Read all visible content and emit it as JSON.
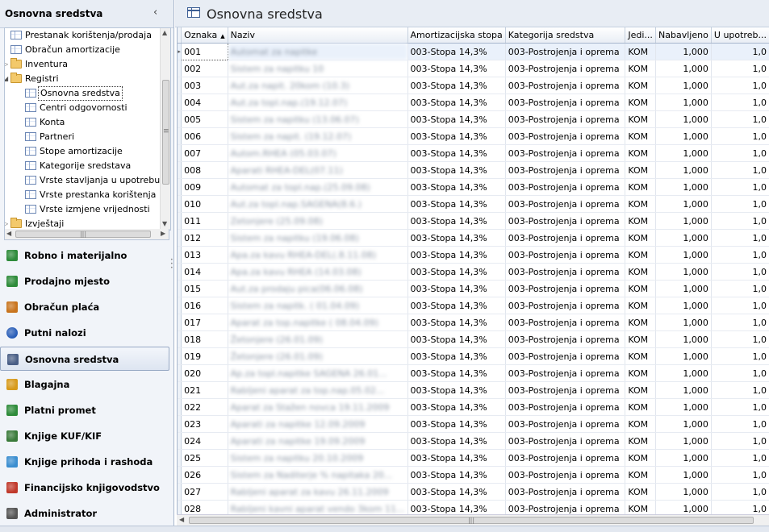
{
  "sidebar": {
    "title": "Osnovna sredstva",
    "collapse_icon": "‹",
    "tree": [
      {
        "label": "Prestanak korištenja/prodaja",
        "icon": "grid",
        "level": 0
      },
      {
        "label": "Obračun amortizacije",
        "icon": "grid",
        "level": 0
      },
      {
        "label": "Inventura",
        "icon": "folder",
        "level": 0,
        "expander": "▷"
      },
      {
        "label": "Registri",
        "icon": "folder",
        "level": 0,
        "expander": "◢"
      },
      {
        "label": "Osnovna sredstva",
        "icon": "grid",
        "level": 1,
        "selected": true
      },
      {
        "label": "Centri odgovornosti",
        "icon": "grid",
        "level": 1
      },
      {
        "label": "Konta",
        "icon": "grid",
        "level": 1
      },
      {
        "label": "Partneri",
        "icon": "grid",
        "level": 1
      },
      {
        "label": "Stope amortizacije",
        "icon": "grid",
        "level": 1
      },
      {
        "label": "Kategorije sredstava",
        "icon": "grid",
        "level": 1
      },
      {
        "label": "Vrste stavljanja u upotrebu",
        "icon": "grid",
        "level": 1
      },
      {
        "label": "Vrste prestanka korištenja",
        "icon": "grid",
        "level": 1
      },
      {
        "label": "Vrste izmjene vrijednosti",
        "icon": "grid",
        "level": 1
      },
      {
        "label": "Izvještaji",
        "icon": "folder",
        "level": 0,
        "expander": "▷"
      }
    ],
    "modules": [
      {
        "label": "Robno i materijalno",
        "icon": "robno-icon",
        "color": "#2e8b3a"
      },
      {
        "label": "Prodajno mjesto",
        "icon": "pos-icon",
        "color": "#2e8b3a"
      },
      {
        "label": "Obračun plaća",
        "icon": "payroll-icon",
        "color": "#c8741e"
      },
      {
        "label": "Putni nalozi",
        "icon": "globe-icon",
        "color": "#2b5fb8"
      },
      {
        "label": "Osnovna sredstva",
        "icon": "assets-icon",
        "color": "#4a5f86",
        "active": true
      },
      {
        "label": "Blagajna",
        "icon": "cash-icon",
        "color": "#d79a1c"
      },
      {
        "label": "Platni promet",
        "icon": "payment-icon",
        "color": "#2e8b3a"
      },
      {
        "label": "Knjige KUF/KIF",
        "icon": "books-icon",
        "color": "#3a7a3a"
      },
      {
        "label": "Knjige prihoda i rashoda",
        "icon": "shield-icon",
        "color": "#3b8ed0"
      },
      {
        "label": "Financijsko knjigovodstvo",
        "icon": "bar-chart-icon",
        "color": "#c0392b"
      },
      {
        "label": "Administrator",
        "icon": "admin-icon",
        "color": "#555555"
      }
    ]
  },
  "content": {
    "title": "Osnovna sredstva",
    "columns": [
      "Oznaka",
      "Naziv",
      "Amortizacijska stopa",
      "Kategorija sredstva",
      "Jedi...",
      "Nabavljeno",
      "U upotreb..."
    ],
    "sort_indicator": "▲",
    "rows": [
      {
        "oznaka": "001",
        "naziv": "Automat za napitke",
        "stopa": "003-Stopa 14,3%",
        "kategorija": "003-Postrojenja i oprema",
        "jed": "KOM",
        "nab": "1,000",
        "upo": "1,0"
      },
      {
        "oznaka": "002",
        "naziv": "Sistem za napitku 10",
        "stopa": "003-Stopa 14,3%",
        "kategorija": "003-Postrojenja i oprema",
        "jed": "KOM",
        "nab": "1,000",
        "upo": "1,0"
      },
      {
        "oznaka": "003",
        "naziv": "Aut.za napit. 20kom (10.3)",
        "stopa": "003-Stopa 14,3%",
        "kategorija": "003-Postrojenja i oprema",
        "jed": "KOM",
        "nab": "1,000",
        "upo": "1,0"
      },
      {
        "oznaka": "004",
        "naziv": "Aut.za topl.nap.(19.12.07)",
        "stopa": "003-Stopa 14,3%",
        "kategorija": "003-Postrojenja i oprema",
        "jed": "KOM",
        "nab": "1,000",
        "upo": "1,0"
      },
      {
        "oznaka": "005",
        "naziv": "Sistem za napitku (13.06.07)",
        "stopa": "003-Stopa 14,3%",
        "kategorija": "003-Postrojenja i oprema",
        "jed": "KOM",
        "nab": "1,000",
        "upo": "1,0"
      },
      {
        "oznaka": "006",
        "naziv": "Sistem za napit. (19.12.07)",
        "stopa": "003-Stopa 14,3%",
        "kategorija": "003-Postrojenja i oprema",
        "jed": "KOM",
        "nab": "1,000",
        "upo": "1,0"
      },
      {
        "oznaka": "007",
        "naziv": "Autom.RHEA (05.03.07)",
        "stopa": "003-Stopa 14,3%",
        "kategorija": "003-Postrojenja i oprema",
        "jed": "KOM",
        "nab": "1,000",
        "upo": "1,0"
      },
      {
        "oznaka": "008",
        "naziv": "Aparati RHEA-DEL(07.11)",
        "stopa": "003-Stopa 14,3%",
        "kategorija": "003-Postrojenja i oprema",
        "jed": "KOM",
        "nab": "1,000",
        "upo": "1,0"
      },
      {
        "oznaka": "009",
        "naziv": "Automat za topl.nap.(25.09.08)",
        "stopa": "003-Stopa 14,3%",
        "kategorija": "003-Postrojenja i oprema",
        "jed": "KOM",
        "nab": "1,000",
        "upo": "1,0"
      },
      {
        "oznaka": "010",
        "naziv": "Aut.za topl.nap.SAGENA(8.6.)",
        "stopa": "003-Stopa 14,3%",
        "kategorija": "003-Postrojenja i oprema",
        "jed": "KOM",
        "nab": "1,000",
        "upo": "1,0"
      },
      {
        "oznaka": "011",
        "naziv": "Zetonjere (25.09.08)",
        "stopa": "003-Stopa 14,3%",
        "kategorija": "003-Postrojenja i oprema",
        "jed": "KOM",
        "nab": "1,000",
        "upo": "1,0"
      },
      {
        "oznaka": "012",
        "naziv": "Sistem za napitku (19.06.08)",
        "stopa": "003-Stopa 14,3%",
        "kategorija": "003-Postrojenja i oprema",
        "jed": "KOM",
        "nab": "1,000",
        "upo": "1,0"
      },
      {
        "oznaka": "013",
        "naziv": "Apa.za kavu RHEA-DEL(.8.11.08)",
        "stopa": "003-Stopa 14,3%",
        "kategorija": "003-Postrojenja i oprema",
        "jed": "KOM",
        "nab": "1,000",
        "upo": "1,0"
      },
      {
        "oznaka": "014",
        "naziv": "Apa.za kavu RHEA (14.03.08)",
        "stopa": "003-Stopa 14,3%",
        "kategorija": "003-Postrojenja i oprema",
        "jed": "KOM",
        "nab": "1,000",
        "upo": "1,0"
      },
      {
        "oznaka": "015",
        "naziv": "Aut.za prodaju pica(06.06.08)",
        "stopa": "003-Stopa 14,3%",
        "kategorija": "003-Postrojenja i oprema",
        "jed": "KOM",
        "nab": "1,000",
        "upo": "1,0"
      },
      {
        "oznaka": "016",
        "naziv": "Sistem za napitk. ( 01.04.09)",
        "stopa": "003-Stopa 14,3%",
        "kategorija": "003-Postrojenja i oprema",
        "jed": "KOM",
        "nab": "1,000",
        "upo": "1,0"
      },
      {
        "oznaka": "017",
        "naziv": "Aparat za top.napitke ( 08.04.09)",
        "stopa": "003-Stopa 14,3%",
        "kategorija": "003-Postrojenja i oprema",
        "jed": "KOM",
        "nab": "1,000",
        "upo": "1,0"
      },
      {
        "oznaka": "018",
        "naziv": "Žetonjere (26.01.09)",
        "stopa": "003-Stopa 14,3%",
        "kategorija": "003-Postrojenja i oprema",
        "jed": "KOM",
        "nab": "1,000",
        "upo": "1,0"
      },
      {
        "oznaka": "019",
        "naziv": "Žetonjere (26.01.09)",
        "stopa": "003-Stopa 14,3%",
        "kategorija": "003-Postrojenja i oprema",
        "jed": "KOM",
        "nab": "1,000",
        "upo": "1,0"
      },
      {
        "oznaka": "020",
        "naziv": "Ap.za topl.napitke SAGENA 26.01...",
        "stopa": "003-Stopa 14,3%",
        "kategorija": "003-Postrojenja i oprema",
        "jed": "KOM",
        "nab": "1,000",
        "upo": "1,0"
      },
      {
        "oznaka": "021",
        "naziv": "Rabljeni aparat za top.nap.05.02...",
        "stopa": "003-Stopa 14,3%",
        "kategorija": "003-Postrojenja i oprema",
        "jed": "KOM",
        "nab": "1,000",
        "upo": "1,0"
      },
      {
        "oznaka": "022",
        "naziv": "Aparat za Stažen novca 19.11.2009",
        "stopa": "003-Stopa 14,3%",
        "kategorija": "003-Postrojenja i oprema",
        "jed": "KOM",
        "nab": "1,000",
        "upo": "1,0"
      },
      {
        "oznaka": "023",
        "naziv": "Aparati za napitke 12.09.2009",
        "stopa": "003-Stopa 14,3%",
        "kategorija": "003-Postrojenja i oprema",
        "jed": "KOM",
        "nab": "1,000",
        "upo": "1,0"
      },
      {
        "oznaka": "024",
        "naziv": "Aparati za napitke 19.09.2009",
        "stopa": "003-Stopa 14,3%",
        "kategorija": "003-Postrojenja i oprema",
        "jed": "KOM",
        "nab": "1,000",
        "upo": "1,0"
      },
      {
        "oznaka": "025",
        "naziv": "Sistem za napitku 20.10.2009",
        "stopa": "003-Stopa 14,3%",
        "kategorija": "003-Postrojenja i oprema",
        "jed": "KOM",
        "nab": "1,000",
        "upo": "1,0"
      },
      {
        "oznaka": "026",
        "naziv": "Sistem za Naditerje % napitaka 20...",
        "stopa": "003-Stopa 14,3%",
        "kategorija": "003-Postrojenja i oprema",
        "jed": "KOM",
        "nab": "1,000",
        "upo": "1,0"
      },
      {
        "oznaka": "027",
        "naziv": "Rabljeni aparat za kavu 26.11.2009",
        "stopa": "003-Stopa 14,3%",
        "kategorija": "003-Postrojenja i oprema",
        "jed": "KOM",
        "nab": "1,000",
        "upo": "1,0"
      },
      {
        "oznaka": "028",
        "naziv": "Rabljeni kavni aparat vendo 3kom 11...",
        "stopa": "003-Stopa 14,3%",
        "kategorija": "003-Postrojenja i oprema",
        "jed": "KOM",
        "nab": "1,000",
        "upo": "1,0"
      }
    ]
  }
}
